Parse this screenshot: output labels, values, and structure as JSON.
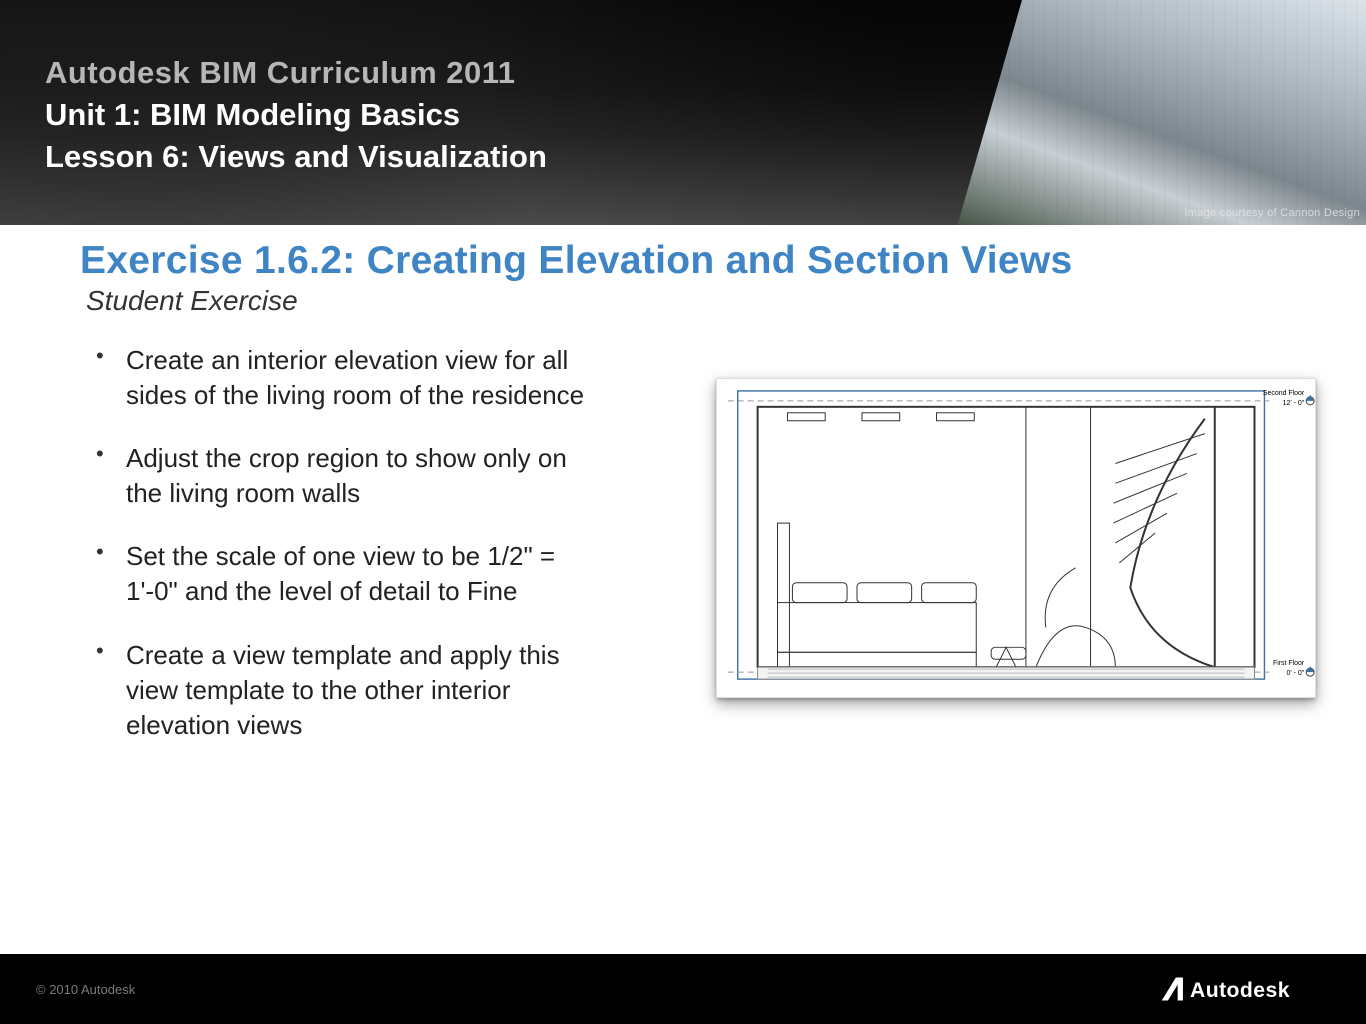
{
  "header": {
    "line1": "Autodesk BIM Curriculum 2011",
    "line2": "Unit 1: BIM Modeling Basics",
    "line3": "Lesson 6: Views and Visualization",
    "credit": "Image courtesy of Cannon Design"
  },
  "content": {
    "exercise_title": "Exercise 1.6.2: Creating Elevation and Section Views",
    "subtitle": "Student Exercise",
    "bullets": [
      "Create an interior elevation view for all sides of the living room of the residence",
      "Adjust the crop region to show only on the living room walls",
      "Set the scale of one view to be 1/2\" = 1'-0\" and the level of detail to Fine",
      "Create a view template and apply this view template to the other interior elevation views"
    ]
  },
  "figure": {
    "levels": [
      {
        "name": "Second Floor",
        "elev": "12' - 0\""
      },
      {
        "name": "First Floor",
        "elev": "0' - 0\""
      }
    ]
  },
  "footer": {
    "copyright": "© 2010 Autodesk",
    "brand": "Autodesk"
  },
  "colors": {
    "accent": "#3f84c4"
  }
}
